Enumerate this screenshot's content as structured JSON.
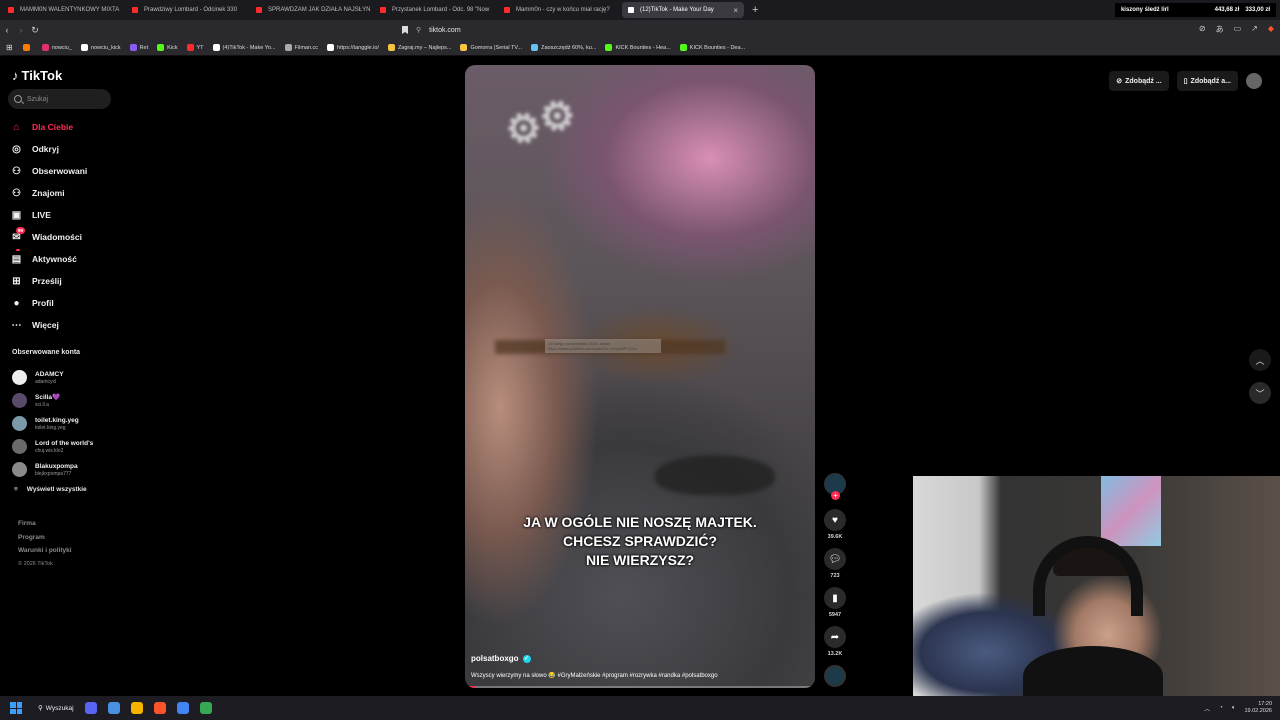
{
  "browser": {
    "tabs": [
      {
        "label": "MAMM0N WALENTYNKOWY MIXTA",
        "color": "#ff2b2b"
      },
      {
        "label": "Prawdziwy Lombard - Odcinek 330",
        "color": "#ff2b2b"
      },
      {
        "label": "SPRAWDZAM JAK DZIAŁA NAJSŁYN",
        "color": "#ff2b2b"
      },
      {
        "label": "Przystanek Lombard - Odc. 98 \"Now",
        "color": "#ff2b2b"
      },
      {
        "label": "Mamm0n - czy w końcu miał rację?",
        "color": "#ff2b2b"
      },
      {
        "label": "(12)TikTok - Make Your Day",
        "color": "#ffffff",
        "active": true
      }
    ],
    "url": "tiktok.com",
    "extension": {
      "name": "kiszony śledź lirl",
      "price_a": "443,68 zł",
      "price_b": "333,00 zł"
    },
    "bookmarks": [
      {
        "label": "",
        "color": "#ff7a00"
      },
      {
        "label": "nowciu_",
        "color": "#e1306c"
      },
      {
        "label": "nowciu_kick",
        "color": "#ffffff"
      },
      {
        "label": "Ret",
        "color": "#8a5cf6"
      },
      {
        "label": "Kick",
        "color": "#53fc18"
      },
      {
        "label": "YT",
        "color": "#ff2b2b"
      },
      {
        "label": "(4)TikTok - Make Yo...",
        "color": "#ffffff"
      },
      {
        "label": "Filman.cc",
        "color": "#aaaaaa"
      },
      {
        "label": "https://tanggle.io/",
        "color": "#ffffff"
      },
      {
        "label": "Zagraj.my – Najleps...",
        "color": "#f5c542"
      },
      {
        "label": "Gomorra (Serial TV...",
        "color": "#f5c542"
      },
      {
        "label": "Zaoszczędź 60%, ku...",
        "color": "#66c0f4"
      },
      {
        "label": "KICK Bounties - Hea...",
        "color": "#53fc18"
      },
      {
        "label": "KICK Bounties - Dea...",
        "color": "#53fc18"
      }
    ]
  },
  "tiktok": {
    "logo": "TikTok",
    "search_placeholder": "Szukaj",
    "nav": [
      {
        "label": "Dla Ciebie",
        "icon": "home-icon",
        "glyph": "⌂",
        "active": true
      },
      {
        "label": "Odkryj",
        "icon": "compass-icon",
        "glyph": "◎"
      },
      {
        "label": "Obserwowani",
        "icon": "user-plus-icon",
        "glyph": "⚇"
      },
      {
        "label": "Znajomi",
        "icon": "friends-icon",
        "glyph": "⚇"
      },
      {
        "label": "LIVE",
        "icon": "live-icon",
        "glyph": "▣"
      },
      {
        "label": "Wiadomości",
        "icon": "message-icon",
        "glyph": "✉",
        "badge": "99"
      },
      {
        "label": "Aktywność",
        "icon": "activity-icon",
        "glyph": "▤",
        "badge": ""
      },
      {
        "label": "Prześlij",
        "icon": "upload-icon",
        "glyph": "⊞"
      },
      {
        "label": "Profil",
        "icon": "profile-icon",
        "glyph": "●"
      },
      {
        "label": "Więcej",
        "icon": "more-icon",
        "glyph": "⋯"
      }
    ],
    "following_title": "Obserwowane konta",
    "accounts": [
      {
        "name": "ADAMCY",
        "handle": "adamcyxl",
        "color": "#eeeeee"
      },
      {
        "name": "Scilla💜",
        "handle": "sci.ll.a",
        "color": "#5a4a6a"
      },
      {
        "name": "toilet.king.yeg",
        "handle": "toilet.king.yeg",
        "color": "#7a9aaa"
      },
      {
        "name": "Lord of the world's",
        "handle": "chuj.wis.klo2",
        "color": "#6a6a6a"
      },
      {
        "name": "Blakuxpompa",
        "handle": "blejkxpompa777",
        "color": "#8a8a8a"
      }
    ],
    "show_all": "Wyświetl wszystkie",
    "footer": [
      "Firma",
      "Program",
      "Warunki i polityki"
    ],
    "copyright": "© 2026 TikTok",
    "topright": {
      "coins": "Zdobądź ...",
      "app": "Zdobądź a..."
    },
    "video": {
      "caption_lines": [
        "JA W OGÓLE NIE NOSZĘ MAJTEK.",
        "CHCESZ SPRAWDZIĆ?",
        "NIE WIERZYSZ?"
      ],
      "author": "polsatboxgo",
      "description": "Wszyscy wierzymy na słowo 😂 #GryMałżeńskie #program #rozrywka #randka #polsatboxgo",
      "tooltip_line1": "15 lutego poniedziałek 2026, obiad",
      "tooltip_line2": "https://www.youtube.com/watch?v=CeyW8P7Q3-s",
      "progress": 0.03
    },
    "actions": {
      "likes": "39.6K",
      "comments": "723",
      "saves": "5947",
      "shares": "13.2K"
    }
  },
  "taskbar": {
    "search_label": "Wyszukaj",
    "time": "17:20",
    "date": "19.02.2026",
    "apps": [
      "#5865f2",
      "#4a90e2",
      "#f4b400",
      "#fb542b",
      "#4285f4",
      "#34a853"
    ]
  }
}
